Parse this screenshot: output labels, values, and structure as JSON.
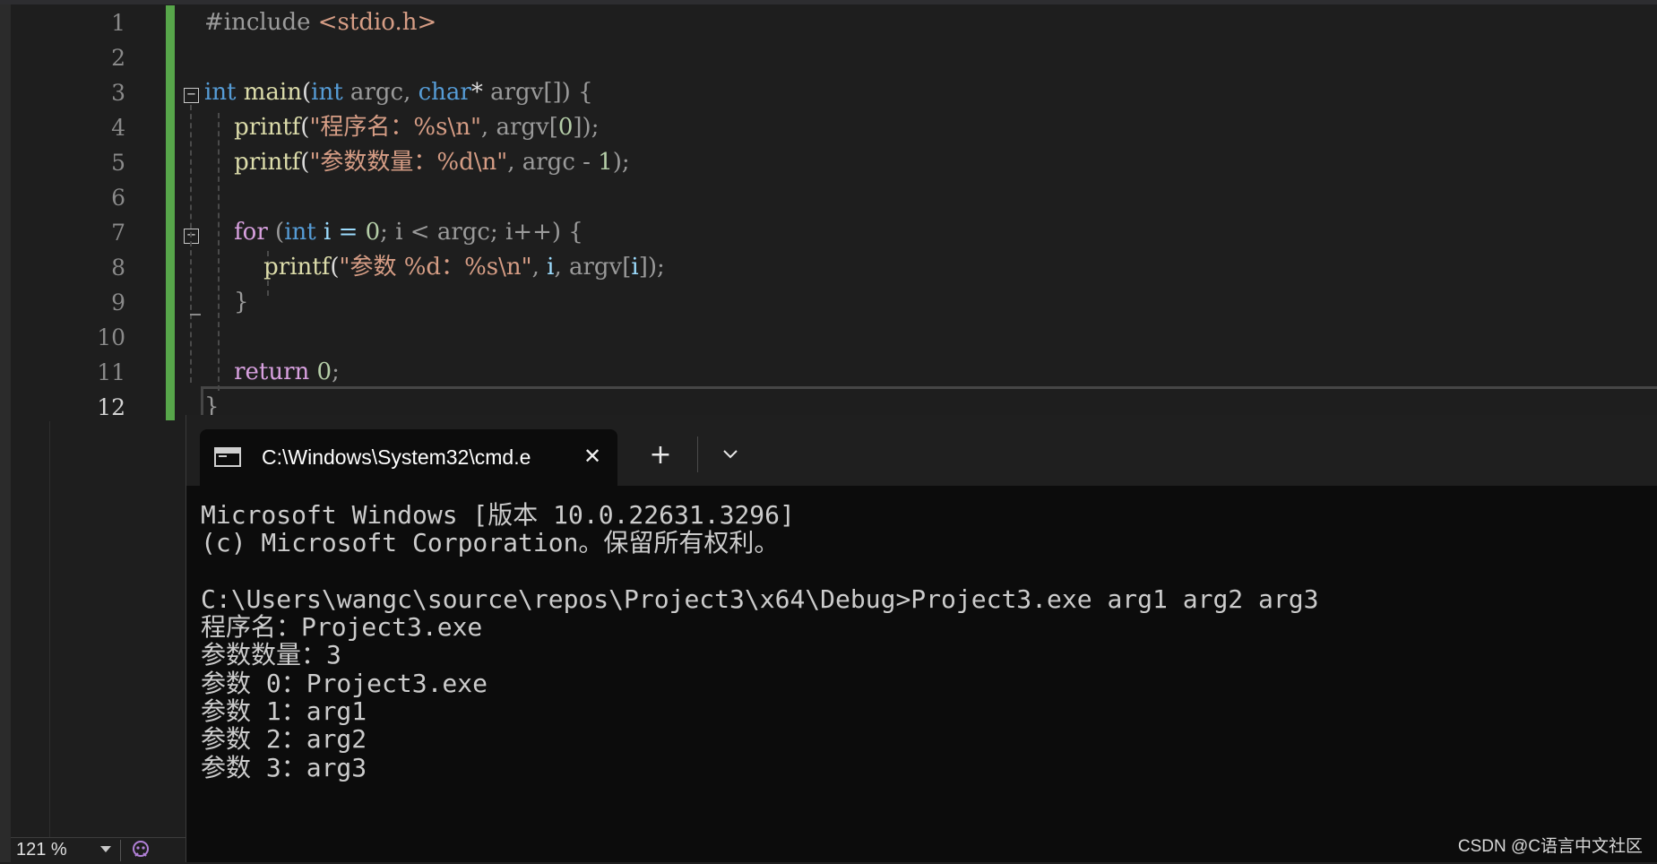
{
  "editor": {
    "line_numbers": [
      "1",
      "2",
      "3",
      "4",
      "5",
      "6",
      "7",
      "8",
      "9",
      "10",
      "11",
      "12"
    ],
    "current_line": "12",
    "zoom_level": "121 %",
    "code_lines": [
      [
        {
          "t": "#include ",
          "c": "#9b9b9b"
        },
        {
          "t": "<stdio.h>",
          "c": "#d69d85"
        }
      ],
      [],
      [
        {
          "t": "int",
          "c": "#569cd6"
        },
        {
          "t": " ",
          "c": "#dcdcdc"
        },
        {
          "t": "main",
          "c": "#dcdcaa"
        },
        {
          "t": "(",
          "c": "#dcdcdc"
        },
        {
          "t": "int",
          "c": "#569cd6"
        },
        {
          "t": " argc, ",
          "c": "#9a9a9a"
        },
        {
          "t": "char",
          "c": "#569cd6"
        },
        {
          "t": "* ",
          "c": "#dcdcdc"
        },
        {
          "t": "argv[]) {",
          "c": "#9a9a9a"
        }
      ],
      [
        {
          "t": "    ",
          "c": "#dcdcdc"
        },
        {
          "t": "printf",
          "c": "#dcdcaa"
        },
        {
          "t": "(",
          "c": "#dcdcdc"
        },
        {
          "t": "\"程序名：%s\\n\"",
          "c": "#d69d85"
        },
        {
          "t": ", argv[",
          "c": "#9a9a9a"
        },
        {
          "t": "0",
          "c": "#b5cea8"
        },
        {
          "t": "]);",
          "c": "#9a9a9a"
        }
      ],
      [
        {
          "t": "    ",
          "c": "#dcdcdc"
        },
        {
          "t": "printf",
          "c": "#dcdcaa"
        },
        {
          "t": "(",
          "c": "#dcdcdc"
        },
        {
          "t": "\"参数数量：%d\\n\"",
          "c": "#d69d85"
        },
        {
          "t": ", argc - ",
          "c": "#9a9a9a"
        },
        {
          "t": "1",
          "c": "#b5cea8"
        },
        {
          "t": ");",
          "c": "#9a9a9a"
        }
      ],
      [],
      [
        {
          "t": "    ",
          "c": "#dcdcdc"
        },
        {
          "t": "for",
          "c": "#d8a0df"
        },
        {
          "t": " (",
          "c": "#9a9a9a"
        },
        {
          "t": "int",
          "c": "#569cd6"
        },
        {
          "t": " i = ",
          "c": "#9cdcfe"
        },
        {
          "t": "0",
          "c": "#b5cea8"
        },
        {
          "t": "; i < argc; i++) {",
          "c": "#9a9a9a"
        }
      ],
      [
        {
          "t": "        ",
          "c": "#dcdcdc"
        },
        {
          "t": "printf",
          "c": "#dcdcaa"
        },
        {
          "t": "(",
          "c": "#dcdcdc"
        },
        {
          "t": "\"参数 %d：%s\\n\"",
          "c": "#d69d85"
        },
        {
          "t": ", ",
          "c": "#9a9a9a"
        },
        {
          "t": "i",
          "c": "#9cdcfe"
        },
        {
          "t": ", argv[",
          "c": "#9a9a9a"
        },
        {
          "t": "i",
          "c": "#9cdcfe"
        },
        {
          "t": "]);",
          "c": "#9a9a9a"
        }
      ],
      [
        {
          "t": "    }",
          "c": "#9a9a9a"
        }
      ],
      [],
      [
        {
          "t": "    ",
          "c": "#dcdcdc"
        },
        {
          "t": "return",
          "c": "#d8a0df"
        },
        {
          "t": " ",
          "c": "#dcdcdc"
        },
        {
          "t": "0",
          "c": "#b5cea8"
        },
        {
          "t": ";",
          "c": "#9a9a9a"
        }
      ],
      [
        {
          "t": "}",
          "c": "#9a9a9a"
        }
      ]
    ]
  },
  "terminal": {
    "tab_title": "C:\\Windows\\System32\\cmd.e",
    "lines": [
      "Microsoft Windows [版本 10.0.22631.3296]",
      "(c) Microsoft Corporation。保留所有权利。",
      "",
      "C:\\Users\\wangc\\source\\repos\\Project3\\x64\\Debug>Project3.exe arg1 arg2 arg3",
      "程序名：Project3.exe",
      "参数数量：3",
      "参数 0：Project3.exe",
      "参数 1：arg1",
      "参数 2：arg2",
      "参数 3：arg3"
    ]
  },
  "watermark": "CSDN @C语言中文社区",
  "icons": {
    "tab_icon": "terminal-icon",
    "close": "close-icon",
    "new_tab": "plus-icon",
    "dropdown": "chevron-down-icon",
    "fold": "collapse-icon",
    "ai": "copilot-icon"
  }
}
